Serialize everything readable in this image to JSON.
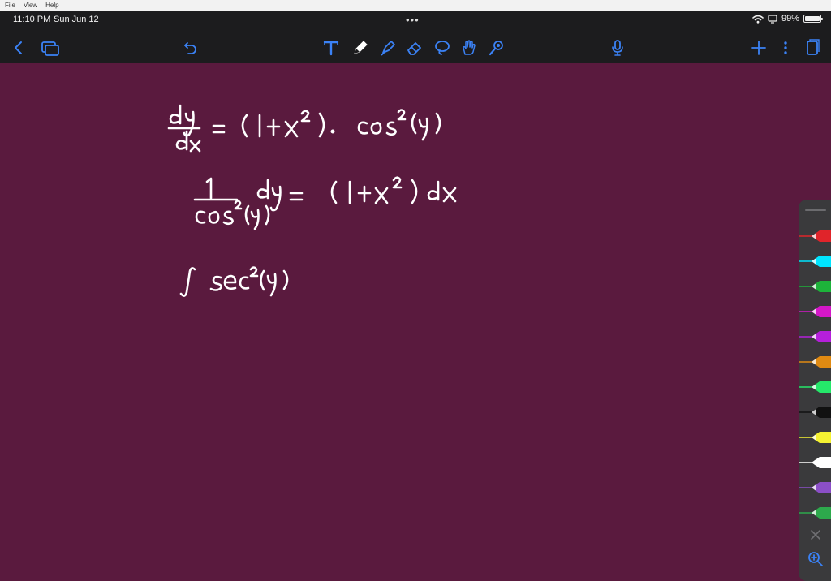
{
  "menubar": {
    "items": [
      "File",
      "View",
      "Help"
    ]
  },
  "status": {
    "time": "11:10 PM",
    "date": "Sun Jun 12",
    "battery": "99%",
    "battery_level": 0.99
  },
  "toolbar": {
    "left": [
      "back-icon",
      "pages-icon",
      "undo-icon"
    ],
    "tools": [
      "text-tool-icon",
      "pen-tool-icon",
      "highlighter-tool-icon",
      "eraser-tool-icon",
      "lasso-tool-icon",
      "hand-tool-icon",
      "laser-tool-icon"
    ],
    "right": [
      "microphone-icon",
      "add-icon",
      "more-icon",
      "page-view-icon"
    ]
  },
  "palette": {
    "pens": [
      "#e0242a",
      "#00e5ff",
      "#1db33a",
      "#d417c8",
      "#b51fdb",
      "#e08a12",
      "#25e86a",
      "#111111",
      "#f5f232",
      "#ffffff",
      "#8b4fc7",
      "#2da94c"
    ],
    "tools": [
      "close-icon",
      "zoom-icon"
    ]
  },
  "colors": {
    "canvas": "#5a1a3e",
    "chrome": "#1c1c1e",
    "ink": "#ffffff"
  },
  "handwriting": [
    "dy/dx = (1+x²)· cos²(y)",
    "1/cos²(y) dy = (1+x²) dx",
    "∫ sec²(y)"
  ]
}
